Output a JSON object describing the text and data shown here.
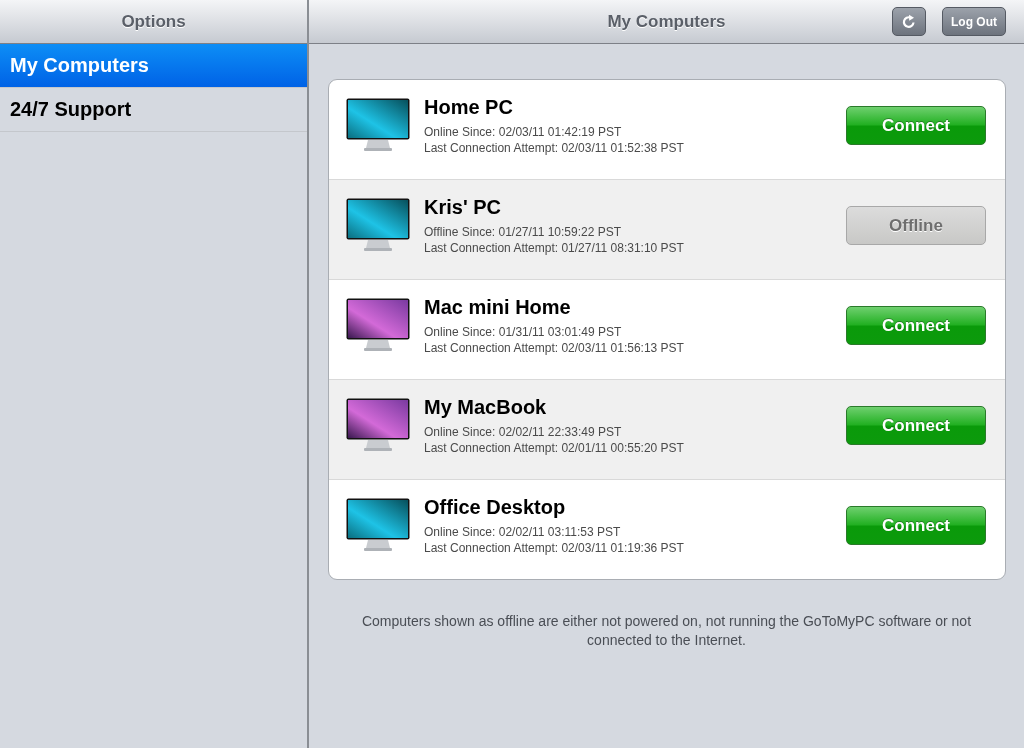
{
  "sidebar": {
    "title": "Options",
    "items": [
      {
        "label": "My Computers",
        "selected": true
      },
      {
        "label": "24/7 Support",
        "selected": false
      }
    ]
  },
  "header": {
    "title": "My Computers",
    "logout": "Log Out"
  },
  "computers": [
    {
      "name": "Home PC",
      "kind": "windows",
      "status_line": "Online Since: 02/03/11 01:42:19 PST",
      "last_attempt": "Last Connection Attempt: 02/03/11 01:52:38 PST",
      "button": "Connect",
      "disabled": false
    },
    {
      "name": "Kris' PC",
      "kind": "windows",
      "status_line": "Offline Since: 01/27/11 10:59:22 PST",
      "last_attempt": "Last Connection Attempt: 01/27/11 08:31:10 PST",
      "button": "Offline",
      "disabled": true
    },
    {
      "name": "Mac mini Home",
      "kind": "mac",
      "status_line": "Online Since: 01/31/11 03:01:49 PST",
      "last_attempt": "Last Connection Attempt: 02/03/11 01:56:13 PST",
      "button": "Connect",
      "disabled": false
    },
    {
      "name": "My MacBook",
      "kind": "mac",
      "status_line": "Online Since: 02/02/11 22:33:49 PST",
      "last_attempt": "Last Connection Attempt: 02/01/11 00:55:20 PST",
      "button": "Connect",
      "disabled": false
    },
    {
      "name": "Office Desktop",
      "kind": "windows",
      "status_line": "Online Since: 02/02/11 03:11:53 PST",
      "last_attempt": "Last Connection Attempt: 02/03/11 01:19:36 PST",
      "button": "Connect",
      "disabled": false
    }
  ],
  "footnote": "Computers shown as offline are either not powered on, not running the GoToMyPC software or not connected to the Internet."
}
